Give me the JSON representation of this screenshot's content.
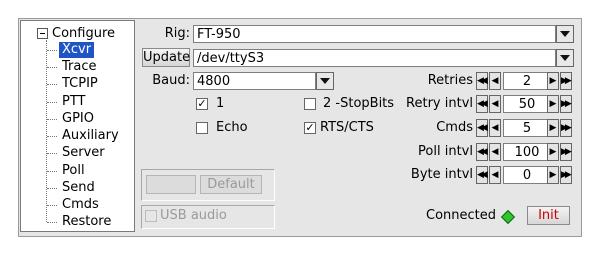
{
  "tree": {
    "root_label": "Configure",
    "items": [
      "Xcvr",
      "Trace",
      "TCPIP",
      "PTT",
      "GPIO",
      "Auxiliary",
      "Server",
      "Poll",
      "Send",
      "Cmds",
      "Restore"
    ],
    "selected": "Xcvr"
  },
  "rig": {
    "label": "Rig:",
    "value": "FT-950"
  },
  "update": {
    "button": "Update",
    "device": "/dev/ttyS3"
  },
  "baud": {
    "label": "Baud:",
    "value": "4800"
  },
  "checks": {
    "one": {
      "label": "1",
      "checked": true
    },
    "two_stopbits": {
      "label": "2 -StopBits",
      "checked": false
    },
    "echo": {
      "label": "Echo",
      "checked": false
    },
    "rtscts": {
      "label": "RTS/CTS",
      "checked": true
    }
  },
  "check_mark": "✓",
  "spinners": [
    {
      "label": "Retries",
      "value": "2"
    },
    {
      "label": "Retry intvl",
      "value": "50"
    },
    {
      "label": "Cmds",
      "value": "5"
    },
    {
      "label": "Poll intvl",
      "value": "100"
    },
    {
      "label": "Byte intvl",
      "value": "0"
    }
  ],
  "spin_arrows": {
    "first": "◀◀",
    "prev": "◀",
    "next": "▶",
    "last": "▶▶"
  },
  "default_button": "Default",
  "usb_audio": {
    "label": "USB audio",
    "checked": false
  },
  "status": {
    "label": "Connected",
    "color": "#2ec52e"
  },
  "init_button": {
    "label": "Init",
    "color": "#cc0000"
  }
}
